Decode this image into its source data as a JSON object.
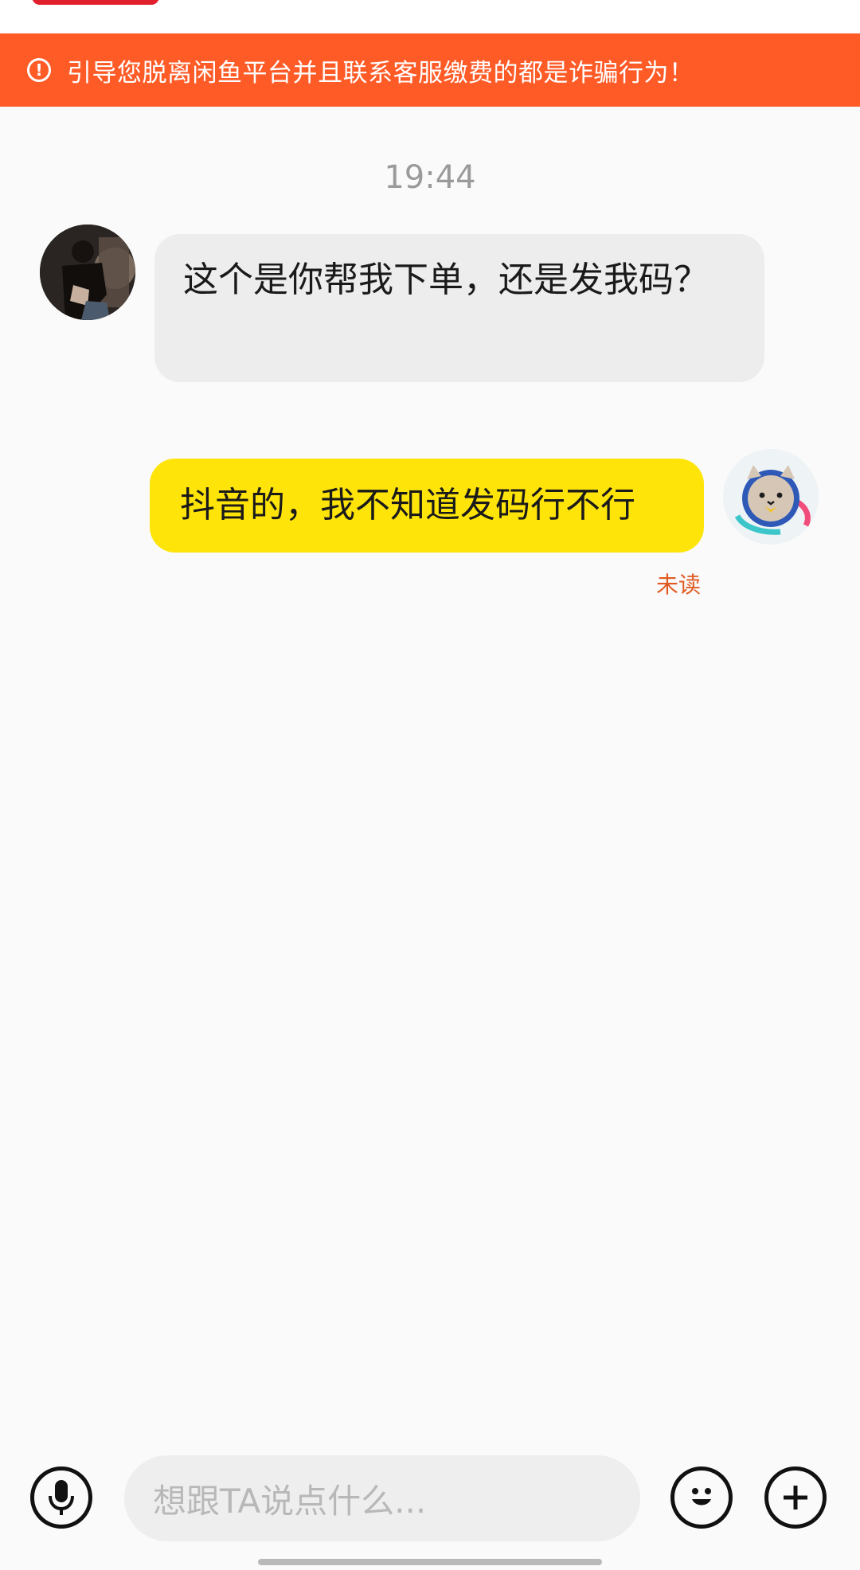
{
  "warning": {
    "icon": "exclamation-circle-icon",
    "text": "引导您脱离闲鱼平台并且联系客服缴费的都是诈骗行为！"
  },
  "chat": {
    "timestamp": "19:44",
    "messages": [
      {
        "side": "left",
        "text": "这个是你帮我下单，还是发我码？"
      },
      {
        "side": "right",
        "text": "抖音的，我不知道发码行不行",
        "status": "未读"
      }
    ]
  },
  "input_bar": {
    "placeholder": "想跟TA说点什么...",
    "left_icon": "microphone-icon",
    "emoji_icon": "emoji-icon",
    "plus_icon": "plus-icon"
  },
  "colors": {
    "warning_bg": "#ff5b27",
    "my_bubble": "#ffe40a",
    "their_bubble": "#ededed",
    "unread_text": "#e05a22"
  }
}
